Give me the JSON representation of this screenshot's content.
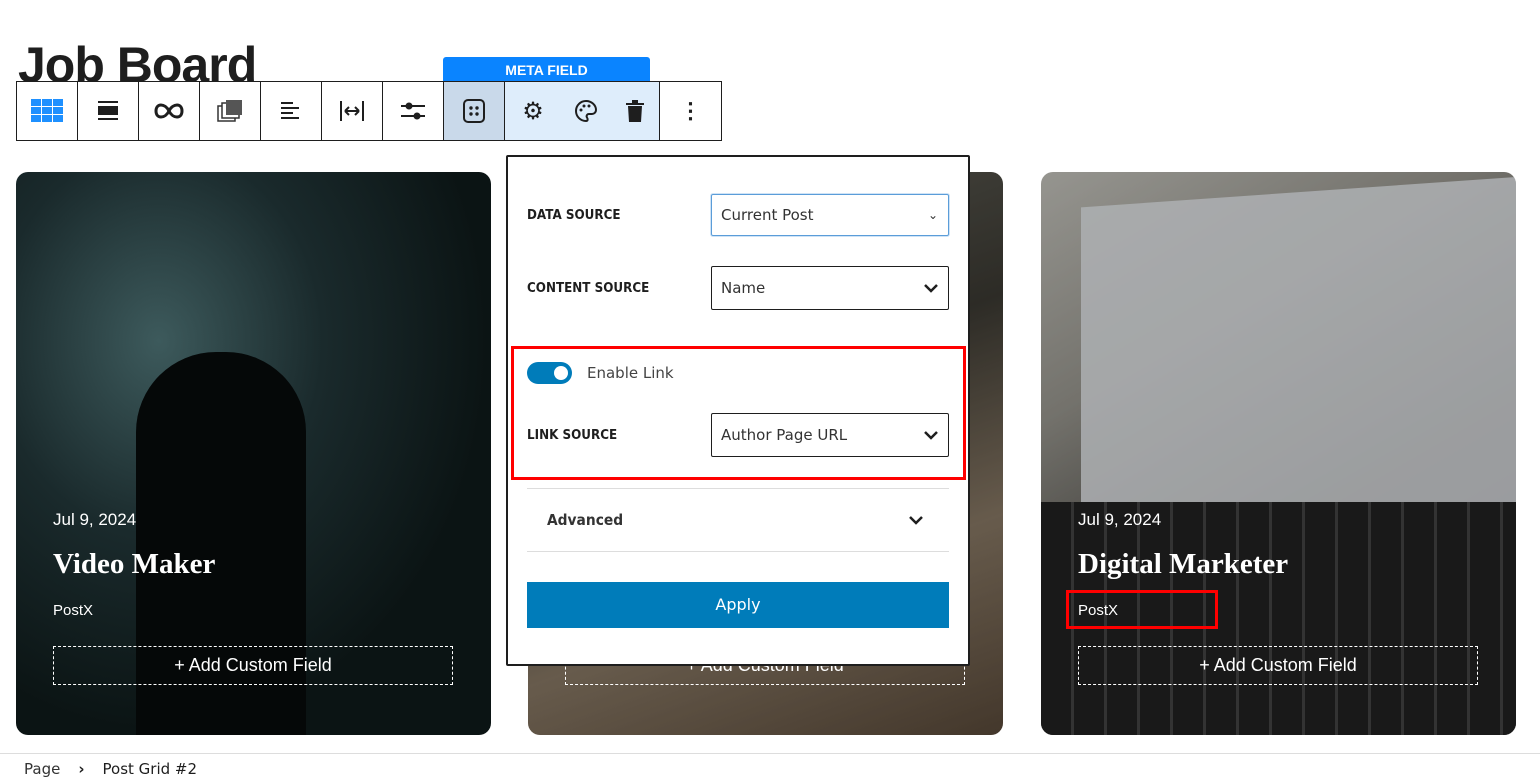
{
  "page": {
    "title": "Job Board"
  },
  "toolbar": {
    "meta_label": "META FIELD",
    "icons": [
      "grid-icon",
      "align-full-icon",
      "link-icon",
      "gallery-icon",
      "align-left-icon",
      "width-icon",
      "sliders-icon",
      "meta-field-icon",
      "gear-icon",
      "palette-icon",
      "trash-icon",
      "more-icon"
    ]
  },
  "cards": [
    {
      "date": "Jul 9, 2024",
      "title": "Video Maker",
      "author": "PostX",
      "add": "+ Add Custom Field"
    },
    {
      "add": "+ Add Custom Field"
    },
    {
      "date": "Jul 9, 2024",
      "title": "Digital Marketer",
      "author": "PostX",
      "add": "+ Add Custom Field"
    }
  ],
  "popup": {
    "data_source_label": "DATA SOURCE",
    "data_source_value": "Current Post",
    "content_source_label": "CONTENT SOURCE",
    "content_source_value": "Name",
    "enable_link_label": "Enable Link",
    "enable_link": true,
    "link_source_label": "LINK SOURCE",
    "link_source_value": "Author Page URL",
    "advanced_label": "Advanced",
    "apply_label": "Apply"
  },
  "breadcrumb": {
    "items": [
      "Page",
      "Post Grid #2"
    ]
  },
  "colors": {
    "accent": "#007cba",
    "meta_label": "#0a84ff",
    "highlight": "#ff0000"
  }
}
